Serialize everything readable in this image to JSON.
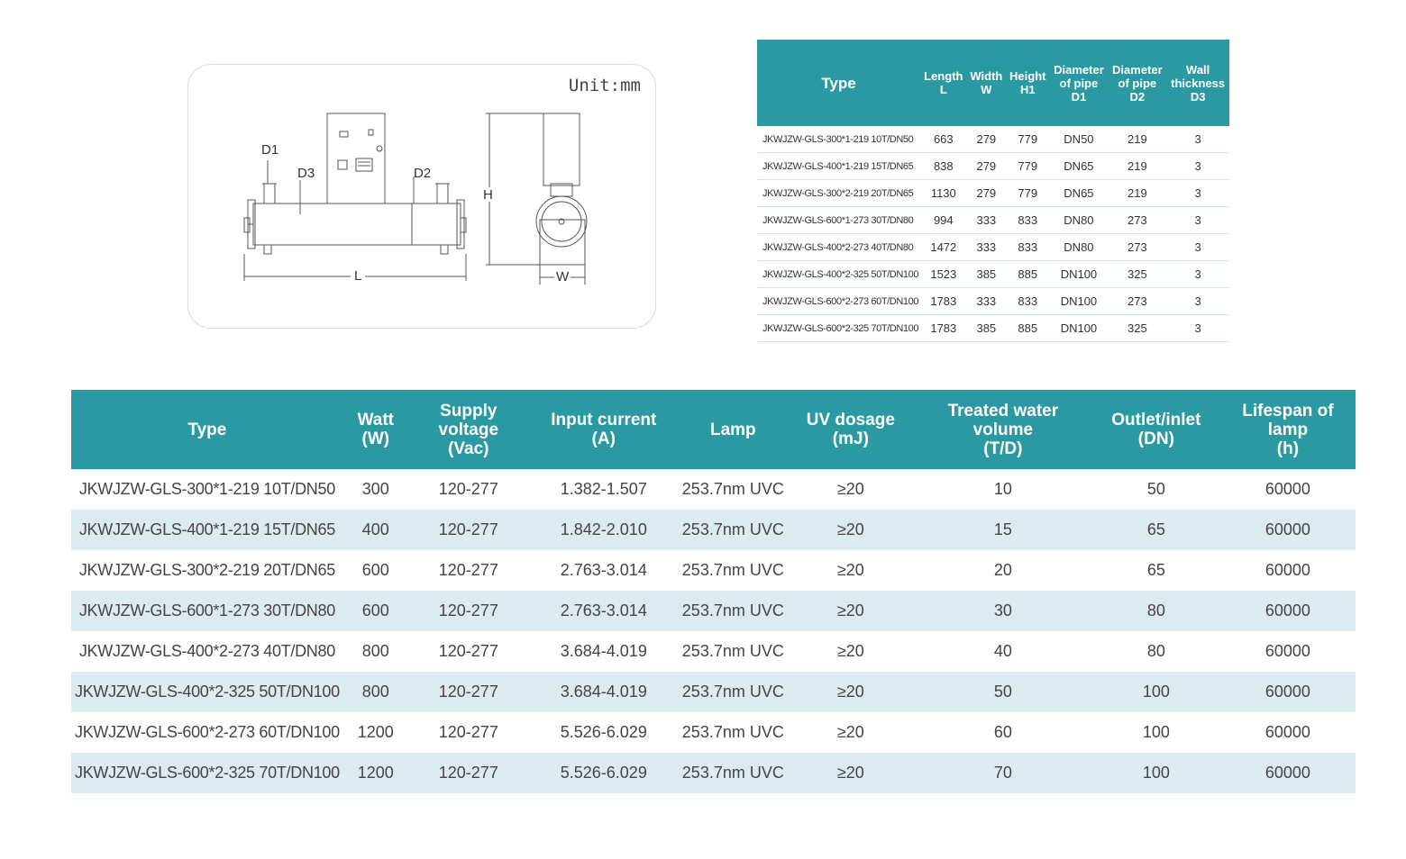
{
  "diagram": {
    "unit": "Unit:mm",
    "labels": {
      "d1": "D1",
      "d2": "D2",
      "d3": "D3",
      "l": "L",
      "h": "H",
      "w": "W"
    }
  },
  "dimensions_table": {
    "headers": [
      {
        "lines": [
          "Type"
        ]
      },
      {
        "lines": [
          "Length",
          "L"
        ]
      },
      {
        "lines": [
          "Width",
          "W"
        ]
      },
      {
        "lines": [
          "Height",
          "H1"
        ]
      },
      {
        "lines": [
          "Diameter",
          "of pipe",
          "D1"
        ]
      },
      {
        "lines": [
          "Diameter",
          "of pipe",
          "D2"
        ]
      },
      {
        "lines": [
          "Wall",
          "thickness",
          "D3"
        ]
      }
    ],
    "rows": [
      [
        "JKWJZW-GLS-300*1-219 10T/DN50",
        "663",
        "279",
        "779",
        "DN50",
        "219",
        "3"
      ],
      [
        "JKWJZW-GLS-400*1-219 15T/DN65",
        "838",
        "279",
        "779",
        "DN65",
        "219",
        "3"
      ],
      [
        "JKWJZW-GLS-300*2-219 20T/DN65",
        "1130",
        "279",
        "779",
        "DN65",
        "219",
        "3"
      ],
      [
        "JKWJZW-GLS-600*1-273 30T/DN80",
        "994",
        "333",
        "833",
        "DN80",
        "273",
        "3"
      ],
      [
        "JKWJZW-GLS-400*2-273 40T/DN80",
        "1472",
        "333",
        "833",
        "DN80",
        "273",
        "3"
      ],
      [
        "JKWJZW-GLS-400*2-325 50T/DN100",
        "1523",
        "385",
        "885",
        "DN100",
        "325",
        "3"
      ],
      [
        "JKWJZW-GLS-600*2-273 60T/DN100",
        "1783",
        "333",
        "833",
        "DN100",
        "273",
        "3"
      ],
      [
        "JKWJZW-GLS-600*2-325 70T/DN100",
        "1783",
        "385",
        "885",
        "DN100",
        "325",
        "3"
      ]
    ]
  },
  "spec_table": {
    "headers": [
      {
        "lines": [
          "Type"
        ]
      },
      {
        "lines": [
          "Watt",
          "(W)"
        ]
      },
      {
        "lines": [
          "Supply voltage",
          "(Vac)"
        ]
      },
      {
        "lines": [
          "Input current",
          "(A)"
        ]
      },
      {
        "lines": [
          "Lamp"
        ]
      },
      {
        "lines": [
          "UV dosage",
          "(mJ)"
        ]
      },
      {
        "lines": [
          "Treated water volume",
          "(T/D)"
        ]
      },
      {
        "lines": [
          "Outlet/inlet",
          "(DN)"
        ]
      },
      {
        "lines": [
          "Lifespan of lamp",
          "(h)"
        ]
      }
    ],
    "rows": [
      [
        "JKWJZW-GLS-300*1-219 10T/DN50",
        "300",
        "120-277",
        "1.382-1.507",
        "253.7nm UVC",
        "≥20",
        "10",
        "50",
        "60000"
      ],
      [
        "JKWJZW-GLS-400*1-219 15T/DN65",
        "400",
        "120-277",
        "1.842-2.010",
        "253.7nm UVC",
        "≥20",
        "15",
        "65",
        "60000"
      ],
      [
        "JKWJZW-GLS-300*2-219 20T/DN65",
        "600",
        "120-277",
        "2.763-3.014",
        "253.7nm UVC",
        "≥20",
        "20",
        "65",
        "60000"
      ],
      [
        "JKWJZW-GLS-600*1-273 30T/DN80",
        "600",
        "120-277",
        "2.763-3.014",
        "253.7nm UVC",
        "≥20",
        "30",
        "80",
        "60000"
      ],
      [
        "JKWJZW-GLS-400*2-273 40T/DN80",
        "800",
        "120-277",
        "3.684-4.019",
        "253.7nm UVC",
        "≥20",
        "40",
        "80",
        "60000"
      ],
      [
        "JKWJZW-GLS-400*2-325 50T/DN100",
        "800",
        "120-277",
        "3.684-4.019",
        "253.7nm UVC",
        "≥20",
        "50",
        "100",
        "60000"
      ],
      [
        "JKWJZW-GLS-600*2-273 60T/DN100",
        "1200",
        "120-277",
        "5.526-6.029",
        "253.7nm UVC",
        "≥20",
        "60",
        "100",
        "60000"
      ],
      [
        "JKWJZW-GLS-600*2-325 70T/DN100",
        "1200",
        "120-277",
        "5.526-6.029",
        "253.7nm UVC",
        "≥20",
        "70",
        "100",
        "60000"
      ]
    ]
  },
  "colors": {
    "header_bg": "#2a99a2",
    "stripe_bg": "#dcebf0",
    "header_text": "#ffffff"
  }
}
